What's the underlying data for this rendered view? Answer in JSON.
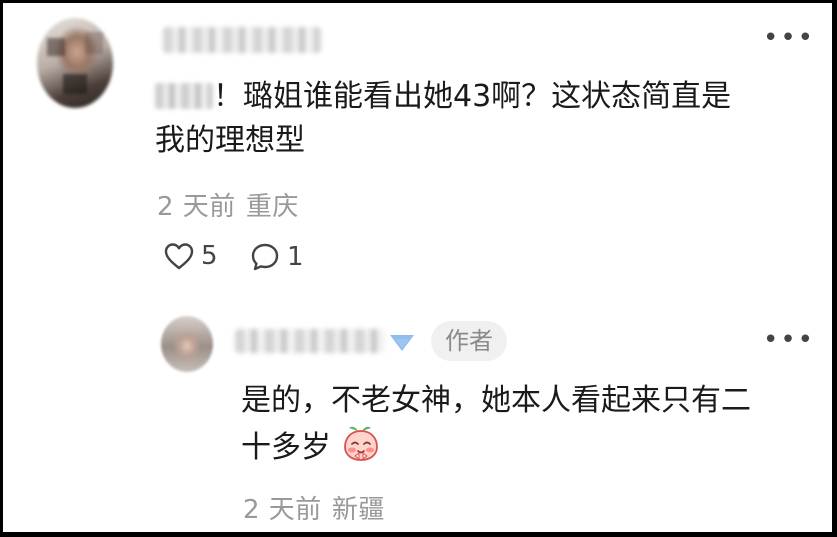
{
  "comment": {
    "text_line1": "！璐姐谁能看出她43啊？这状态简直是",
    "text_line2": "我的理想型",
    "time": "2 天前",
    "location": "重庆",
    "like_count": "5",
    "reply_count": "1",
    "icons": [
      "more-icon",
      "heart-icon",
      "comment-icon"
    ]
  },
  "reply": {
    "badge": "作者",
    "text_line1": "是的，不老女神，她本人看起来只有二",
    "text_line2": "十多岁",
    "emoji": "blushing-peach-emoji",
    "time": "2 天前",
    "location": "新疆",
    "icons": [
      "more-icon",
      "verified-icon"
    ]
  },
  "colors": {
    "text": "#1a1a1a",
    "meta": "#999999",
    "badge_bg": "#f0f0f0",
    "badge_text": "#8a8a8a",
    "verified": "#6aa8e8"
  }
}
